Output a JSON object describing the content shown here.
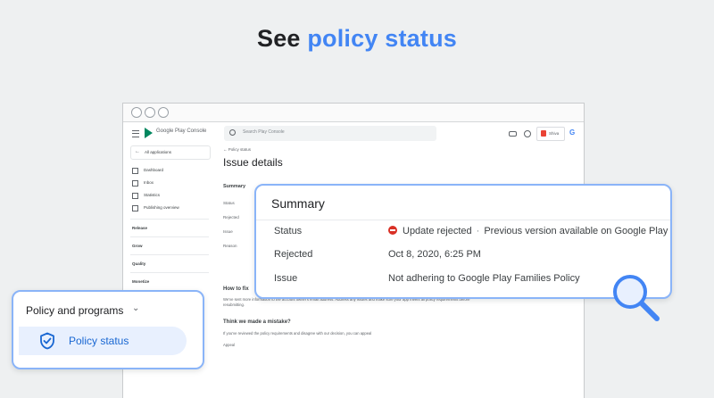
{
  "headline": {
    "prefix": "See",
    "accent": "policy status"
  },
  "console": {
    "brand": "Google Play Console",
    "search_placeholder": "Search Play Console",
    "account_label": "Shiva",
    "google_letter": "G",
    "all_applications": "All applications",
    "nav": [
      "Dashboard",
      "Inbox",
      "Statistics",
      "Publishing overview"
    ],
    "sections": [
      "Release",
      "Grow",
      "Quality",
      "Monetize"
    ],
    "breadcrumb": "Policy status",
    "page_title": "Issue details",
    "mini_summary": "Summary",
    "mini_labels": [
      "Status",
      "Rejected",
      "Issue",
      "Reason"
    ],
    "how_to_fix": "How to fix",
    "fix_text": "We've sent more information to the account owner's email address. Address any issues and make sure your app meets all policy requirements before resubmitting.",
    "mistake_heading": "Think we made a mistake?",
    "mistake_text": "If you've reviewed the policy requirements and disagree with our decision, you can appeal",
    "appeal": "Appeal"
  },
  "summary": {
    "title": "Summary",
    "rows": [
      {
        "label": "Status",
        "value": "Update rejected",
        "extra": "Previous version available on Google Play"
      },
      {
        "label": "Rejected",
        "value": "Oct 8, 2020, 6:25 PM"
      },
      {
        "label": "Issue",
        "value": "Not adhering to Google Play Families Policy"
      }
    ],
    "status_color": "#d93025"
  },
  "policy_menu": {
    "heading": "Policy and programs",
    "item": "Policy status",
    "accent_color": "#1967d2"
  }
}
